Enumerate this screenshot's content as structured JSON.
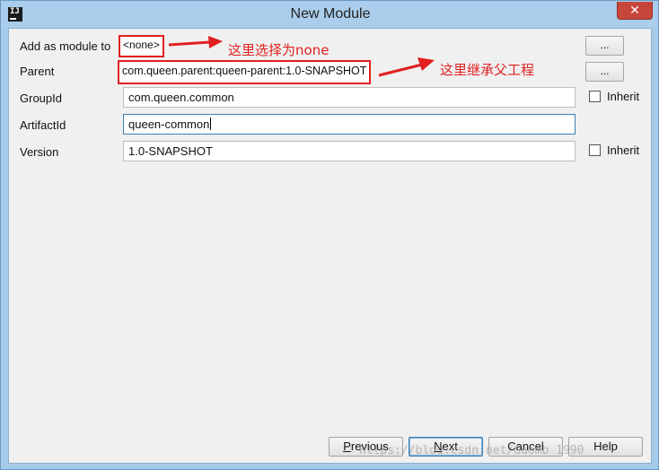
{
  "window": {
    "title": "New Module",
    "icon_text": "IJ",
    "close_glyph": "✕"
  },
  "form": {
    "add_as_module": {
      "label": "Add as module to",
      "value": "<none>",
      "browse_label": "..."
    },
    "parent": {
      "label": "Parent",
      "value": "com.queen.parent:queen-parent:1.0-SNAPSHOT",
      "browse_label": "..."
    },
    "group_id": {
      "label": "GroupId",
      "value": "com.queen.common",
      "inherit_label": "Inherit",
      "inherit_checked": false
    },
    "artifact_id": {
      "label": "ArtifactId",
      "value": "queen-common"
    },
    "version": {
      "label": "Version",
      "value": "1.0-SNAPSHOT",
      "inherit_label": "Inherit",
      "inherit_checked": false
    }
  },
  "annotations": {
    "module_note": "这里选择为none",
    "parent_note": "这里继承父工程",
    "color": "#e02020"
  },
  "buttons": {
    "previous": {
      "mnemonic": "P",
      "rest": "revious"
    },
    "next": {
      "mnemonic": "N",
      "rest": "ext"
    },
    "cancel": "Cancel",
    "help": "Help"
  },
  "watermark": "https://blog.csdn.net/Gaomb_1990"
}
